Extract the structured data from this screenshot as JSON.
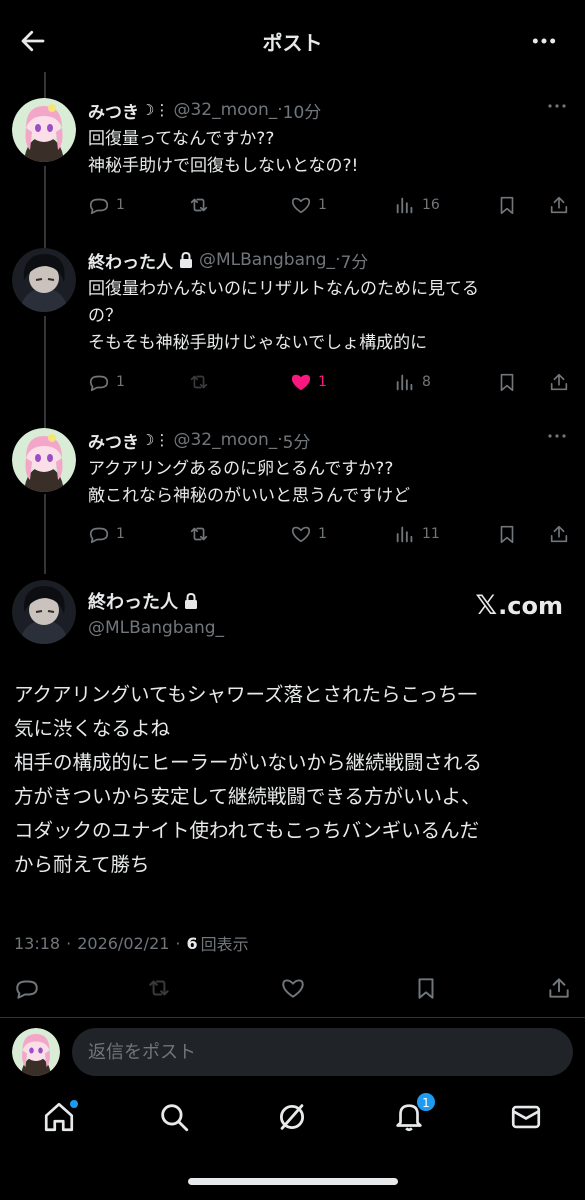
{
  "header": {
    "title": "ポスト"
  },
  "tweets": [
    {
      "name": "みつき",
      "name_suffix": "☽⋮",
      "handle": "@32_moon_",
      "dot": "·",
      "time": "10分",
      "lines": [
        "回復量ってなんですか??",
        "神秘手助けで回復もしないとなの?!"
      ],
      "replies": "1",
      "reposts": "",
      "likes": "1",
      "views": "16"
    },
    {
      "name": "終わった人",
      "handle": "@MLBangbang_",
      "dot": "·",
      "time": "7分",
      "lines": [
        "回復量わかんないのにリザルトなんのために見てる",
        "の？",
        "そもそも神秘手助けじゃないでしょ構成的に"
      ],
      "replies": "1",
      "reposts": "",
      "likes": "1",
      "views": "8"
    },
    {
      "name": "みつき",
      "name_suffix": "☽⋮",
      "handle": "@32_moon_",
      "dot": "·",
      "time": "5分",
      "lines": [
        "アクアリングあるのに卵とるんですか??",
        "敵これなら神秘のがいいと思うんですけど"
      ],
      "replies": "1",
      "reposts": "",
      "likes": "1",
      "views": "11"
    }
  ],
  "main": {
    "name": "終わった人",
    "handle": "@MLBangbang_",
    "watermark": ".com",
    "watermark_logo": "𝕏",
    "lines": [
      "アクアリングいてもシャワーズ落とされたらこっち一",
      "気に渋くなるよね",
      "相手の構成的にヒーラーがいないから継続戦闘される",
      "方がきついから安定して継続戦闘できる方がいいよ、",
      "コダックのユナイト使われてもこっちバンギいるんだ",
      "から耐えて勝ち"
    ],
    "time": "13:18",
    "date": "2026/02/21",
    "sep": "·",
    "views_count": "6",
    "views_label": "回表示"
  },
  "reply": {
    "placeholder": "返信をポスト"
  },
  "tabbar": {
    "notifications_badge": "1"
  },
  "colors": {
    "accent": "#1d9bf0",
    "like": "#f91880",
    "muted": "#71767b",
    "text": "#e7e9ea",
    "bg": "#000000"
  }
}
